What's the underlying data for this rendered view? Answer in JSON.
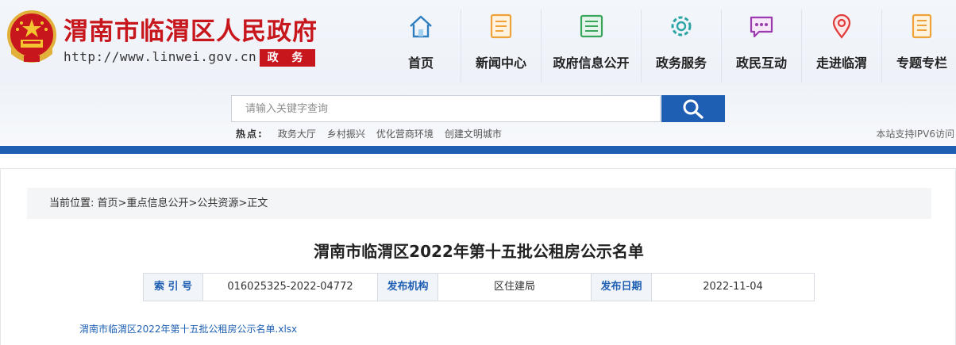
{
  "header": {
    "site_title": "渭南市临渭区人民政府",
    "site_url": "http://www.linwei.gov.cn",
    "badge": "政 务",
    "brand_color": "#c8161d",
    "accent_color": "#1e5fb3"
  },
  "nav": {
    "items": [
      {
        "label": "首页",
        "icon": "home-icon"
      },
      {
        "label": "新闻中心",
        "icon": "document-list-icon"
      },
      {
        "label": "政府信息公开",
        "icon": "info-board-icon"
      },
      {
        "label": "政务服务",
        "icon": "gear-icon"
      },
      {
        "label": "政民互动",
        "icon": "chat-bubble-icon"
      },
      {
        "label": "走进临渭",
        "icon": "location-pin-icon"
      },
      {
        "label": "专题专栏",
        "icon": "topics-icon"
      }
    ]
  },
  "search": {
    "placeholder": "请输入关键字查询",
    "button_icon": "search-icon"
  },
  "hot": {
    "label": "热点:",
    "links": [
      "政务大厅",
      "乡村振兴",
      "优化营商环境",
      "创建文明城市"
    ]
  },
  "ipv6_notice": "本站支持IPV6访问",
  "breadcrumb": {
    "prefix": "当前位置:",
    "items": [
      "首页",
      "重点信息公开",
      "公共资源",
      "正文"
    ],
    "separator": ">"
  },
  "article": {
    "title": "渭南市临渭区2022年第十五批公租房公示名单",
    "meta": {
      "index_label": "索 引 号",
      "index_value": "016025325-2022-04772",
      "org_label": "发布机构",
      "org_value": "区住建局",
      "date_label": "发布日期",
      "date_value": "2022-11-04"
    },
    "attachment": "渭南市临渭区2022年第十五批公租房公示名单.xlsx"
  }
}
